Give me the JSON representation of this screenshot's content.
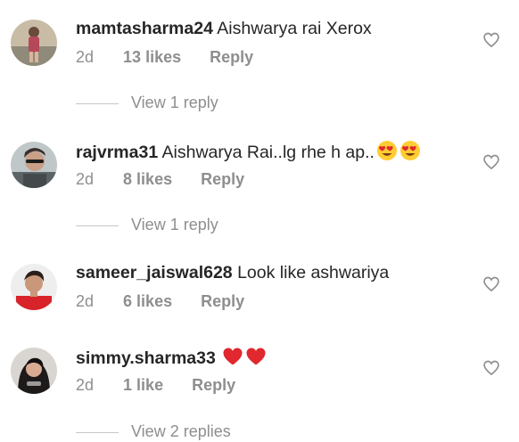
{
  "comments": [
    {
      "username": "mamtasharma24",
      "text": "Aishwarya rai Xerox",
      "age": "2d",
      "likes": "13 likes",
      "reply_label": "Reply",
      "view_replies": "View 1 reply",
      "emoji": []
    },
    {
      "username": "rajvrma31",
      "text": "Aishwarya Rai..lg rhe h ap..",
      "age": "2d",
      "likes": "8 likes",
      "reply_label": "Reply",
      "view_replies": "View 1 reply",
      "emoji": [
        "heart-eyes-emoji",
        "heart-eyes-emoji"
      ]
    },
    {
      "username": "sameer_jaiswal628",
      "text": "Look like ashwariya",
      "age": "2d",
      "likes": "6 likes",
      "reply_label": "Reply",
      "view_replies": "",
      "emoji": []
    },
    {
      "username": "simmy.sharma33",
      "text": "",
      "age": "2d",
      "likes": "1 like",
      "reply_label": "Reply",
      "view_replies": "View 2 replies",
      "emoji": [
        "red-heart-emoji",
        "red-heart-emoji"
      ]
    }
  ],
  "icons": {
    "like": "heart-outline-icon"
  },
  "colors": {
    "text": "#262626",
    "secondary": "#8e8e8e",
    "divider": "#c7c7c7",
    "emoji_heart": "#e0282e"
  }
}
